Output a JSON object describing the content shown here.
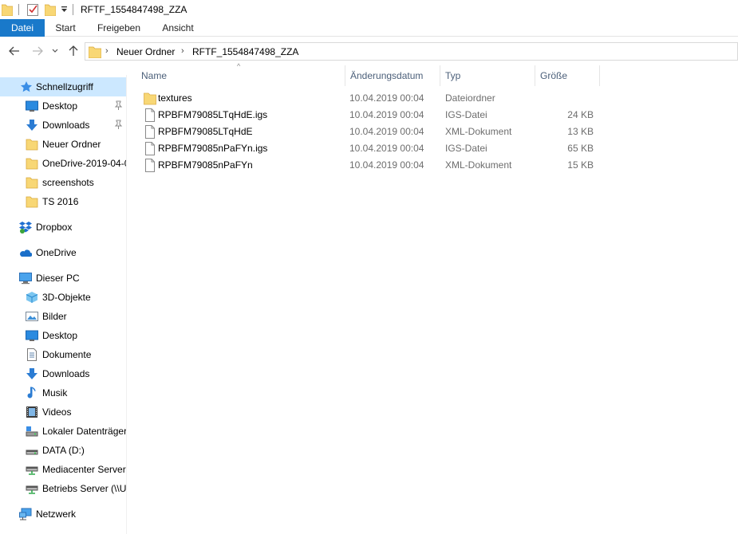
{
  "window": {
    "title": "RFTF_1554847498_ZZA"
  },
  "ribbon": {
    "tabs": [
      "Datei",
      "Start",
      "Freigeben",
      "Ansicht"
    ]
  },
  "address": {
    "crumbs": [
      "Neuer Ordner",
      "RFTF_1554847498_ZZA"
    ]
  },
  "columns": {
    "name": "Name",
    "date": "Änderungsdatum",
    "type": "Typ",
    "size": "Größe"
  },
  "files": [
    {
      "icon": "folder-icon",
      "name": "textures",
      "date": "10.04.2019 00:04",
      "type": "Dateiordner",
      "size": ""
    },
    {
      "icon": "file-icon",
      "name": "RPBFM79085LTqHdE.igs",
      "date": "10.04.2019 00:04",
      "type": "IGS-Datei",
      "size": "24 KB"
    },
    {
      "icon": "file-icon",
      "name": "RPBFM79085LTqHdE",
      "date": "10.04.2019 00:04",
      "type": "XML-Dokument",
      "size": "13 KB"
    },
    {
      "icon": "file-icon",
      "name": "RPBFM79085nPaFYn.igs",
      "date": "10.04.2019 00:04",
      "type": "IGS-Datei",
      "size": "65 KB"
    },
    {
      "icon": "file-icon",
      "name": "RPBFM79085nPaFYn",
      "date": "10.04.2019 00:04",
      "type": "XML-Dokument",
      "size": "15 KB"
    }
  ],
  "sidebar": {
    "quick_access": "Schnellzugriff",
    "quick_items": [
      {
        "label": "Desktop",
        "icon": "desktop-icon",
        "pinned": true
      },
      {
        "label": "Downloads",
        "icon": "download-icon",
        "pinned": true
      },
      {
        "label": "Neuer Ordner",
        "icon": "folder-icon",
        "pinned": false
      },
      {
        "label": "OneDrive-2019-04-0",
        "icon": "folder-icon",
        "pinned": false
      },
      {
        "label": "screenshots",
        "icon": "folder-icon",
        "pinned": false
      },
      {
        "label": "TS 2016",
        "icon": "folder-icon",
        "pinned": false
      }
    ],
    "dropbox": "Dropbox",
    "onedrive": "OneDrive",
    "this_pc": "Dieser PC",
    "pc_items": [
      {
        "label": "3D-Objekte",
        "icon": "cube-icon"
      },
      {
        "label": "Bilder",
        "icon": "pictures-icon"
      },
      {
        "label": "Desktop",
        "icon": "desktop-icon"
      },
      {
        "label": "Dokumente",
        "icon": "documents-icon"
      },
      {
        "label": "Downloads",
        "icon": "download-icon"
      },
      {
        "label": "Musik",
        "icon": "music-icon"
      },
      {
        "label": "Videos",
        "icon": "video-icon"
      },
      {
        "label": "Lokaler Datenträger",
        "icon": "drive-icon"
      },
      {
        "label": "DATA (D:)",
        "icon": "drive-icon"
      },
      {
        "label": "Mediacenter Server",
        "icon": "network-drive-icon"
      },
      {
        "label": "Betriebs Server (\\\\U",
        "icon": "network-drive-icon"
      }
    ],
    "network": "Netzwerk"
  },
  "colors": {
    "accent": "#1979ca",
    "selected": "#cce8ff",
    "folder": "#f8d775",
    "header_text": "#4c607a"
  }
}
